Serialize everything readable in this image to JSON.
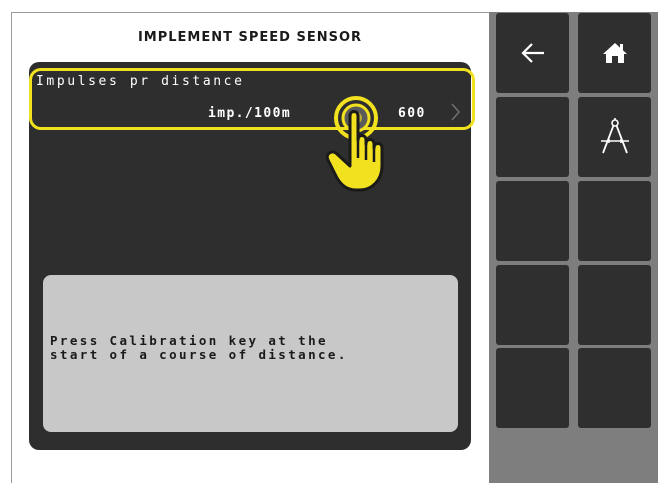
{
  "screen": {
    "title": "IMPLEMENT SPEED SENSOR",
    "parameter": {
      "label": "Impulses pr distance",
      "unit": "imp./100m",
      "value": "600"
    },
    "message_lines": [
      "Press Calibration key at the",
      "start of a course of distance."
    ]
  },
  "softkeys": [
    {
      "icon": "arrow-left-icon"
    },
    {
      "icon": "home-icon"
    },
    {
      "icon": ""
    },
    {
      "icon": "calibration-compass-icon"
    },
    {
      "icon": ""
    },
    {
      "icon": ""
    },
    {
      "icon": ""
    },
    {
      "icon": ""
    },
    {
      "icon": ""
    },
    {
      "icon": ""
    }
  ],
  "colors": {
    "highlight": "#f2e11e",
    "panel": "#2e2e2e",
    "softkey": "#2f2f2f",
    "softkey_background": "#7e7e7e",
    "message_background": "#c8c8c8"
  }
}
